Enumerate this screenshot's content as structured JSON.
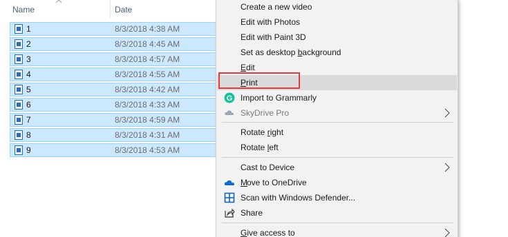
{
  "header": {
    "name_label": "Name",
    "date_label": "Date"
  },
  "files": [
    {
      "name": "1",
      "date": "8/3/2018 4:38 AM"
    },
    {
      "name": "2",
      "date": "8/3/2018 4:45 AM"
    },
    {
      "name": "3",
      "date": "8/3/2018 4:57 AM"
    },
    {
      "name": "4",
      "date": "8/3/2018 4:55 AM"
    },
    {
      "name": "5",
      "date": "8/3/2018 4:42 AM"
    },
    {
      "name": "6",
      "date": "8/3/2018 4:33 AM"
    },
    {
      "name": "7",
      "date": "8/3/2018 4:59 AM"
    },
    {
      "name": "8",
      "date": "8/3/2018 4:31 AM"
    },
    {
      "name": "9",
      "date": "8/3/2018 4:53 AM"
    }
  ],
  "menu": {
    "create_video": "Create a new video",
    "edit_photos": "Edit with Photos",
    "edit_paint3d": "Edit with Paint 3D",
    "set_background_pre": "Set as desktop ",
    "set_background_u": "b",
    "set_background_post": "ackground",
    "edit_u": "E",
    "edit_post": "dit",
    "print_u": "P",
    "print_post": "rint",
    "import_grammarly": "Import to Grammarly",
    "skydrive_pro": "SkyDrive Pro",
    "rotate_right_pre": "Rotate ",
    "rotate_right_u": "r",
    "rotate_right_post": "ight",
    "rotate_left_pre": "Rotate ",
    "rotate_left_u": "l",
    "rotate_left_post": "eft",
    "cast_device": "Cast to Device",
    "move_onedrive": "Move to OneDrive",
    "scan_defender": "Scan with Windows Defender...",
    "share": "Share",
    "give_access_u": "G",
    "give_access_post": "ive access to"
  },
  "colors": {
    "selection": "#cce8ff",
    "highlight_border": "#e23c3c",
    "grammarly": "#15c39a",
    "onedrive": "#0a6cd6",
    "defender": "#1565c0"
  }
}
